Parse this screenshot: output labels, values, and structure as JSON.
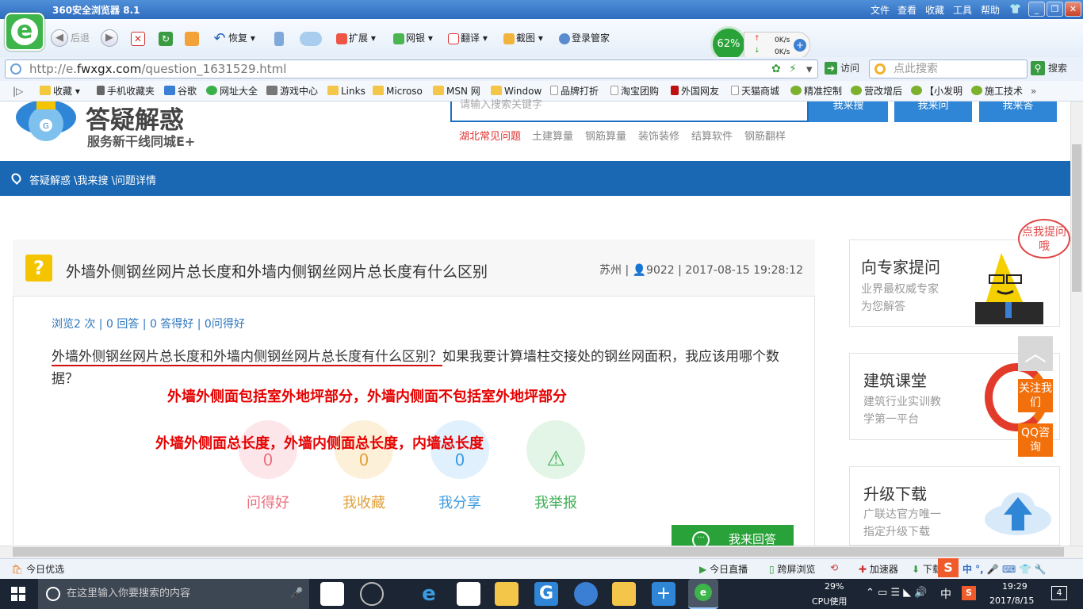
{
  "browser": {
    "title": "360安全浏览器 8.1",
    "menu": [
      "文件",
      "查看",
      "收藏",
      "工具",
      "帮助"
    ],
    "back_label": "后退",
    "restore_label": "恢复",
    "toolbar_items": [
      "扩展",
      "网银",
      "翻译",
      "截图",
      "登录管家"
    ],
    "gauge_percent": "62%",
    "upload_speed": "0K/s",
    "download_speed": "0K/s",
    "url_prefix": "http://e.",
    "url_domain": "fwxgx.com",
    "url_path": "/question_1631529.html",
    "visit_label": "访问",
    "search_placeholder": "点此搜索",
    "search_label": "搜索",
    "bookmarks": [
      "收藏",
      "手机收藏夹",
      "谷歌",
      "网址大全",
      "游戏中心",
      "Links",
      "Microso",
      "MSN 网",
      "Window",
      "品牌打折",
      "淘宝团购",
      "外国网友",
      "天猫商城",
      "精准控制",
      "营改增后",
      "【小发明",
      "施工技术"
    ]
  },
  "site": {
    "logo_text": "答疑解惑",
    "logo_sub": "服务新干线同城E+",
    "search_placeholder": "请输入搜索关键字",
    "search_buttons": [
      "我来搜",
      "我来问",
      "我来答"
    ],
    "hot_links": [
      "湖北常见问题",
      "土建算量",
      "钢筋算量",
      "装饰装修",
      "结算软件",
      "钢筋翻样"
    ],
    "breadcrumb": "答疑解惑 \\我来搜 \\问题详情"
  },
  "question": {
    "title": "外墙外侧钢丝网片总长度和外墙内侧钢丝网片总长度有什么区别",
    "meta": "苏州 | 👤9022 | 2017-08-15 19:28:12",
    "stats": "浏览2 次 | 0 回答 | 0 答得好 | 0问得好",
    "body_underlined": "外墙外侧钢丝网片总长度和外墙内侧钢丝网片总长度有什么区别？",
    "body_rest": "如果我要计算墙柱交接处的钢丝网面积，我应该用哪个数据？",
    "annotation1": "外墙外侧面包括室外地坪部分，外墙内侧面不包括室外地坪部分",
    "annotation2": "外墙外侧面总长度，外墙内侧面总长度，内墙总长度",
    "actions": [
      {
        "label": "问得好",
        "count": "0",
        "color": "#e8707e",
        "bg": "#fde6ea"
      },
      {
        "label": "我收藏",
        "count": "0",
        "color": "#e0a13b",
        "bg": "#fdf0d9"
      },
      {
        "label": "我分享",
        "count": "0",
        "color": "#3b9be0",
        "bg": "#e0f0fc"
      },
      {
        "label": "我举报",
        "count": "",
        "color": "#3fae55",
        "bg": "#e3f5e6"
      }
    ],
    "answer_label": "我来回答"
  },
  "sidebar": {
    "bubble": "点我提问哦",
    "card1_title": "向专家提问",
    "card1_sub1": "业界最权威专家",
    "card1_sub2": "为您解答",
    "card2_title": "建筑课堂",
    "card2_sub1": "建筑行业实训教",
    "card2_sub2": "学第一平台",
    "card3_title": "升级下载",
    "card3_sub1": "广联达官方唯一",
    "card3_sub2": "指定升级下载",
    "follow": "关注我们",
    "qq": "QQ咨询"
  },
  "statusbar": {
    "left": "今日优选",
    "items": [
      "今日直播",
      "跨屏浏览",
      "加速器",
      "下载"
    ]
  },
  "taskbar": {
    "search_placeholder": "在这里输入你要搜索的内容",
    "cpu_percent": "29%",
    "cpu_label": "CPU使用",
    "ime": "中",
    "time": "19:29",
    "date": "2017/8/15",
    "notifications": "4"
  }
}
